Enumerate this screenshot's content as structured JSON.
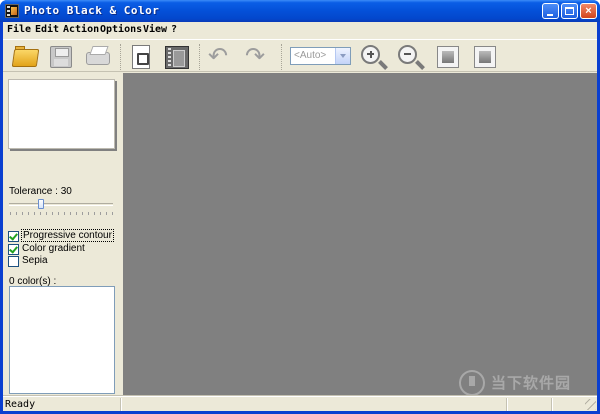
{
  "window": {
    "title": "Photo Black & Color",
    "minimize_icon": "minimize-icon",
    "maximize_icon": "maximize-icon",
    "close_label": "×"
  },
  "menu": {
    "items": [
      "File",
      "Edit",
      "Action",
      "Options",
      "View",
      "?"
    ]
  },
  "toolbar": {
    "icons": [
      "open-folder-icon",
      "save-disk-icon",
      "printer-icon",
      "single-image-icon",
      "film-strip-icon",
      "rotate-left-icon",
      "rotate-right-icon",
      "zoom-in-icon",
      "zoom-out-icon",
      "fit-window-icon",
      "actual-size-icon"
    ],
    "zoom_value": "<Auto>"
  },
  "left_panel": {
    "tolerance_label": "Tolerance : 30",
    "tolerance_value": 30,
    "checkboxes": [
      {
        "label": "Progressive contour",
        "checked": true
      },
      {
        "label": "Color gradient",
        "checked": true
      },
      {
        "label": "Sepia",
        "checked": false
      }
    ],
    "colors_label": "0 color(s) :"
  },
  "canvas": {
    "background": "#808080"
  },
  "status": {
    "text": "Ready"
  },
  "watermark": {
    "text": "当下软件园"
  }
}
